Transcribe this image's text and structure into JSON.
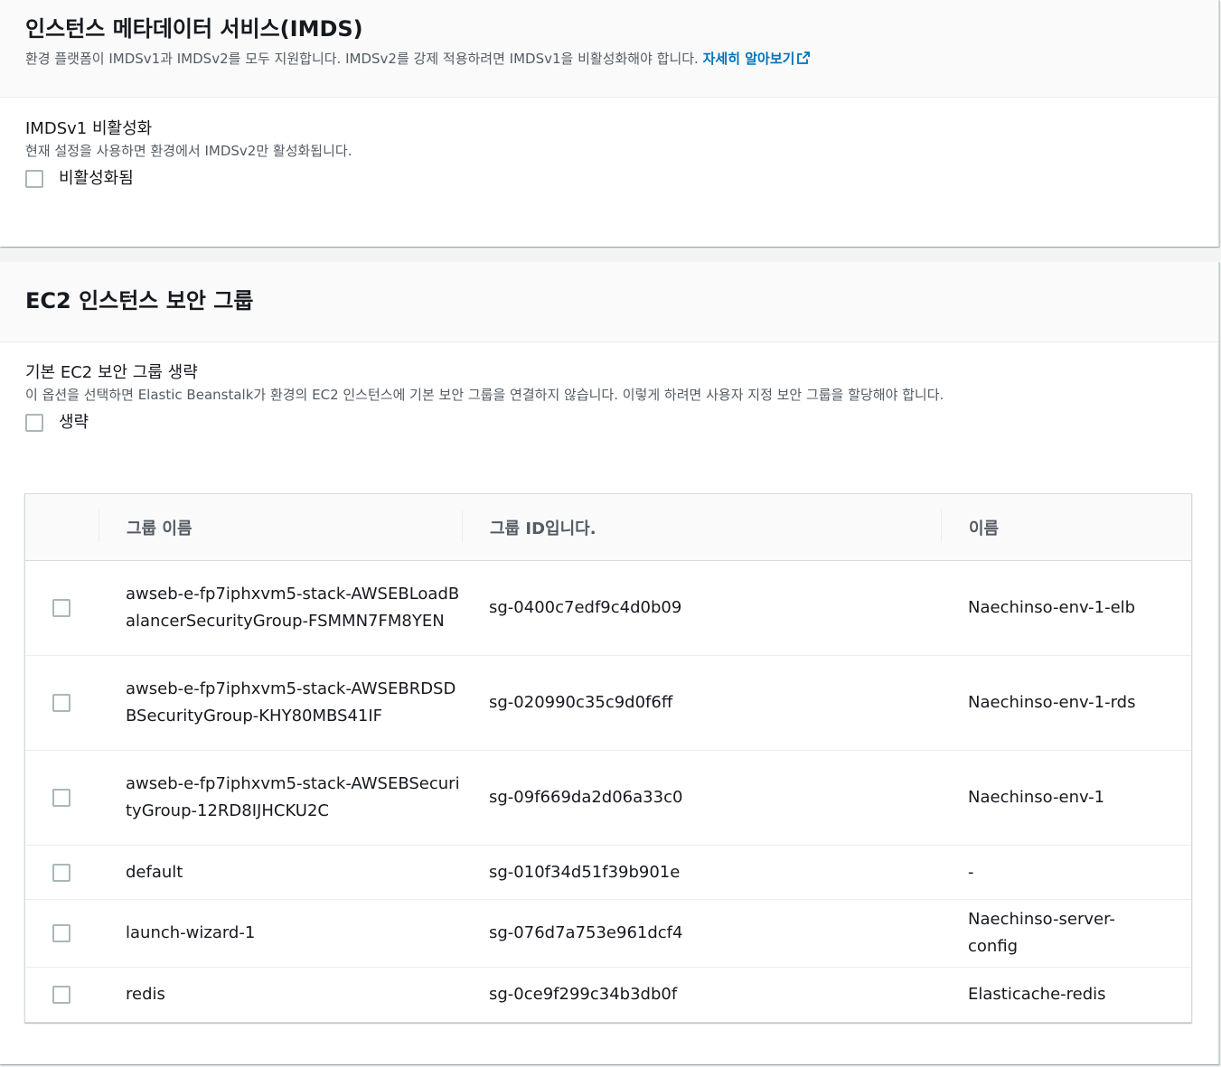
{
  "imds": {
    "title": "인스턴스 메타데이터 서비스(IMDS)",
    "description": "환경 플랫폼이 IMDSv1과 IMDSv2를 모두 지원합니다. IMDSv2를 강제 적용하려면 IMDSv1을 비활성화해야 합니다.",
    "learn_more": "자세히 알아보기",
    "field_label": "IMDSv1 비활성화",
    "field_description": "현재 설정을 사용하면 환경에서 IMDSv2만 활성화됩니다.",
    "checkbox_label": "비활성화됨"
  },
  "security_group": {
    "title": "EC2 인스턴스 보안 그룹",
    "field_label": "기본 EC2 보안 그룹 생략",
    "field_description": "이 옵션을 선택하면 Elastic Beanstalk가 환경의 EC2 인스턴스에 기본 보안 그룹을 연결하지 않습니다. 이렇게 하려면 사용자 지정 보안 그룹을 할당해야 합니다.",
    "checkbox_label": "생략",
    "table": {
      "columns": [
        "그룹 이름",
        "그룹 ID입니다.",
        "이름"
      ],
      "rows": [
        {
          "group_name": "awseb-e-fp7iphxvm5-stack-AWSEBLoadBalancerSecurityGroup-FSMMN7FM8YEN",
          "group_id": "sg-0400c7edf9c4d0b09",
          "name": "Naechinso-env-1-elb"
        },
        {
          "group_name": "awseb-e-fp7iphxvm5-stack-AWSEBRDSDBSecurityGroup-KHY80MBS41IF",
          "group_id": "sg-020990c35c9d0f6ff",
          "name": "Naechinso-env-1-rds"
        },
        {
          "group_name": "awseb-e-fp7iphxvm5-stack-AWSEBSecurityGroup-12RD8IJHCKU2C",
          "group_id": "sg-09f669da2d06a33c0",
          "name": "Naechinso-env-1"
        },
        {
          "group_name": "default",
          "group_id": "sg-010f34d51f39b901e",
          "name": "-"
        },
        {
          "group_name": "launch-wizard-1",
          "group_id": "sg-076d7a753e961dcf4",
          "name": "Naechinso-server-config"
        },
        {
          "group_name": "redis",
          "group_id": "sg-0ce9f299c34b3db0f",
          "name": "Elasticache-redis"
        }
      ]
    }
  },
  "colors": {
    "link": "#0073bb",
    "text": "#16191f",
    "secondary_text": "#545b64",
    "border": "#d5dbdb"
  }
}
